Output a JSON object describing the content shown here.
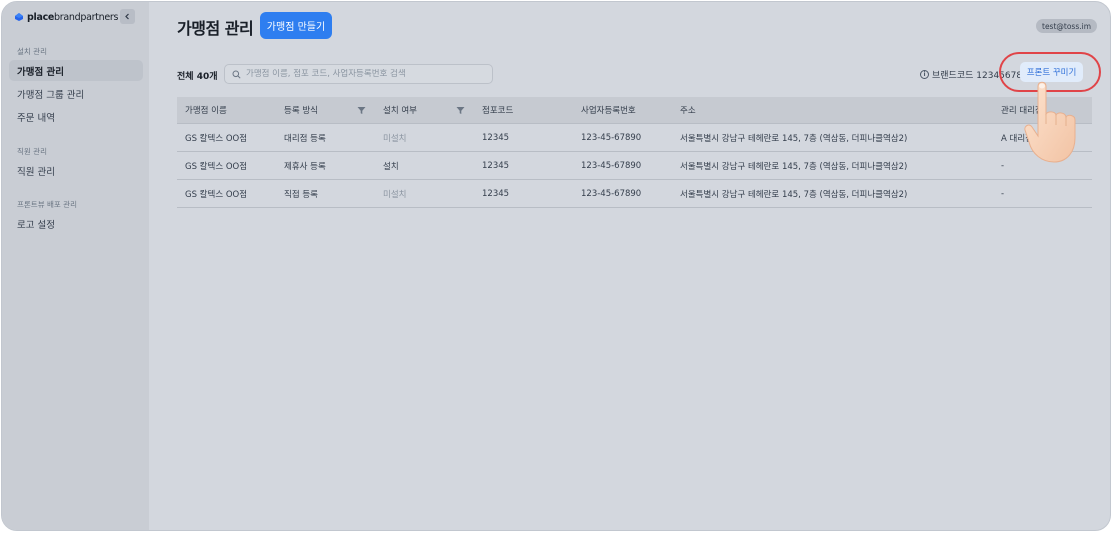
{
  "sidebar": {
    "logo_bold": "place",
    "logo_rest": "brandpartners",
    "collapse_icon": "chevron-left-icon",
    "sections": [
      {
        "label": "설치 관리",
        "items": [
          {
            "label": "가맹점 관리",
            "active": true
          },
          {
            "label": "가맹점 그룹 관리",
            "active": false
          },
          {
            "label": "주문 내역",
            "active": false
          }
        ]
      },
      {
        "label": "직원 관리",
        "items": [
          {
            "label": "직원 관리",
            "active": false
          }
        ]
      },
      {
        "label": "프론트뷰 배포 관리",
        "items": [
          {
            "label": "로고 설정",
            "active": false
          }
        ]
      }
    ]
  },
  "header": {
    "title": "가맹점 관리",
    "create_button": "가맹점 만들기",
    "user": "test@toss.im"
  },
  "toolbar": {
    "total_prefix": "전체 ",
    "total_count": "40",
    "total_suffix": "개",
    "search_placeholder": "가맹점 이름, 점포 코드, 사업자등록번호 검색",
    "brand_code_label": "브랜드코드 12345678",
    "front_button": "프론트 꾸미기"
  },
  "table": {
    "columns": [
      "가맹점 이름",
      "등록 방식",
      "설치 여부",
      "점포코드",
      "사업자등록번호",
      "주소",
      "관리 대리점"
    ],
    "rows": [
      [
        "GS 칼텍스 OO점",
        "대리점 등록",
        "미설치",
        "12345",
        "123-45-67890",
        "서울특별시 강남구 테헤란로 145, 7층 (역삼동, 더피나클역삼2)",
        "A 대리점"
      ],
      [
        "GS 칼텍스 OO점",
        "제휴사 등록",
        "설치",
        "12345",
        "123-45-67890",
        "서울특별시 강남구 테헤란로 145, 7층 (역삼동, 더피나클역삼2)",
        "-"
      ],
      [
        "GS 칼텍스 OO점",
        "직접 등록",
        "미설치",
        "12345",
        "123-45-67890",
        "서울특별시 강남구 테헤란로 145, 7층 (역삼동, 더피나클역삼2)",
        "-"
      ]
    ]
  },
  "colors": {
    "accent": "#2e7ef0",
    "highlight": "#e04448"
  }
}
